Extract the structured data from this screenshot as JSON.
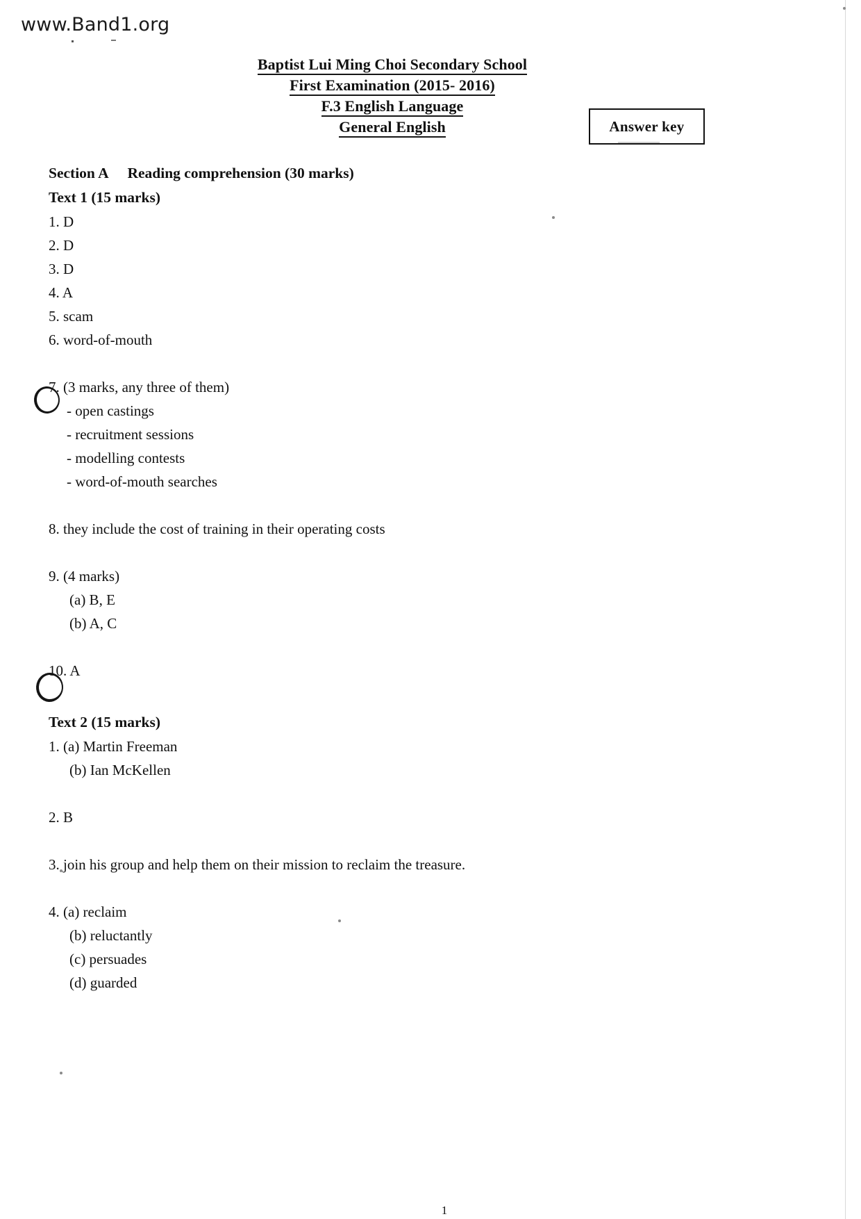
{
  "watermark": "www.Band1.org",
  "header": {
    "school": "Baptist Lui Ming Choi Secondary School",
    "exam": "First Examination (2015- 2016)",
    "level": "F.3 English Language",
    "paper": "General English",
    "answer_key_label": "Answer key"
  },
  "sections": {
    "section_a_heading": "Section A  Reading comprehension (30 marks)",
    "text1_heading": "Text 1 (15 marks)",
    "text2_heading": "Text 2 (15 marks)"
  },
  "text1_answers": {
    "q1": "1. D",
    "q2": "2. D",
    "q3": "3. D",
    "q4": "4. A",
    "q5": "5. scam",
    "q6": "6. word-of-mouth",
    "q7_stem": "7. (3 marks, any three of them)",
    "q7_options": [
      "- open castings",
      "- recruitment sessions",
      "- modelling contests",
      "- word-of-mouth searches"
    ],
    "q8": "8. they include the cost of training in their operating costs",
    "q9_stem": "9. (4 marks)",
    "q9_parts": [
      "(a) B, E",
      "(b) A, C"
    ],
    "q10": "10. A"
  },
  "text2_answers": {
    "q1_stem": "1. (a) Martin Freeman",
    "q1_parts": [
      "(b) Ian McKellen"
    ],
    "q2": "2. B",
    "q3": "3. join his group and help them on their mission to reclaim the treasure.",
    "q4_stem": "4. (a) reclaim",
    "q4_parts": [
      "(b) reluctantly",
      "(c) persuades",
      "(d) guarded"
    ]
  },
  "footer": {
    "page_number": "1"
  }
}
